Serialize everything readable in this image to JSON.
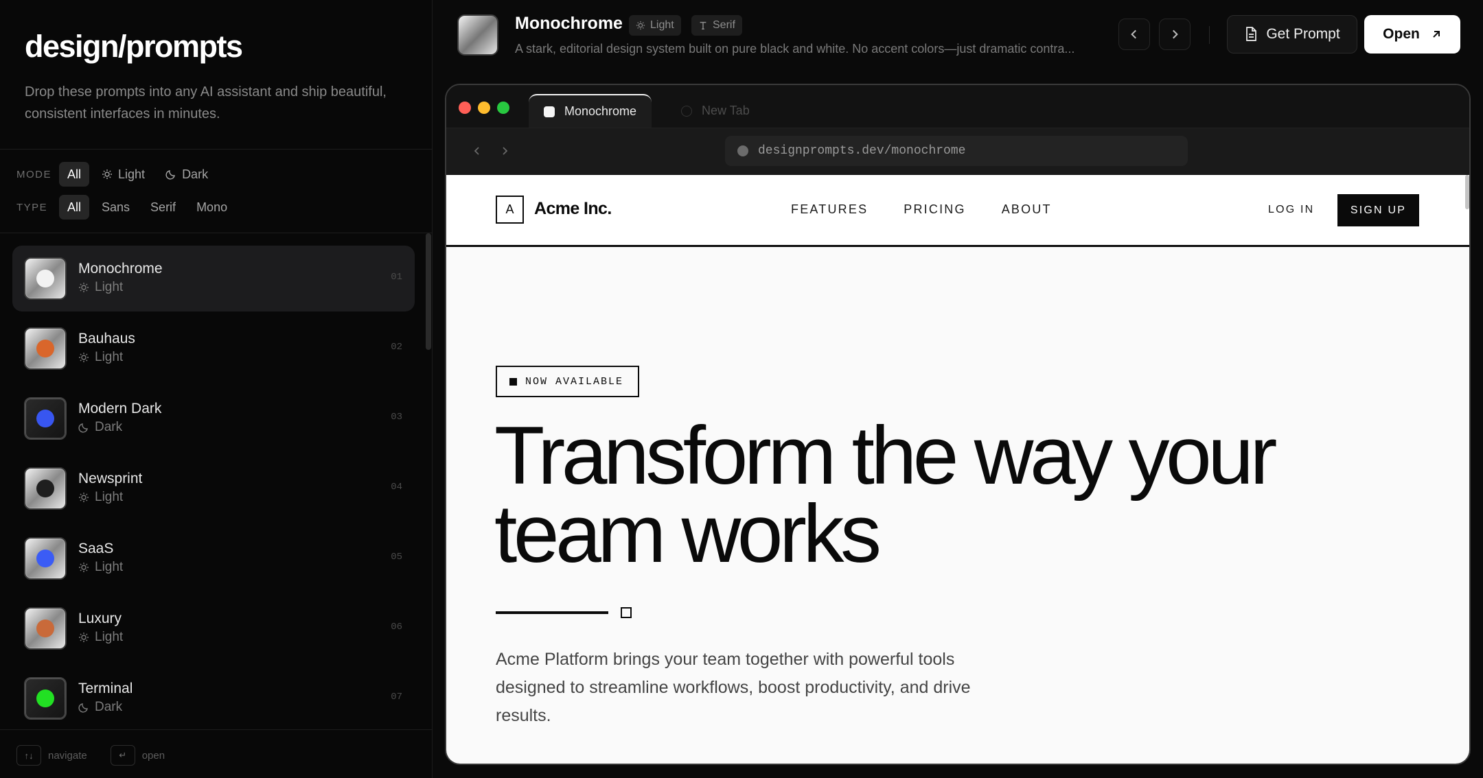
{
  "sidebar": {
    "brand": "design/prompts",
    "tagline": "Drop these prompts into any AI assistant and ship beautiful, consistent interfaces in minutes.",
    "mode_filter": {
      "label": "MODE",
      "options": [
        {
          "label": "All",
          "icon": "",
          "active": true
        },
        {
          "label": "Light",
          "icon": "sun-icon",
          "active": false
        },
        {
          "label": "Dark",
          "icon": "moon-icon",
          "active": false
        }
      ]
    },
    "type_filter": {
      "label": "TYPE",
      "options": [
        {
          "label": "All",
          "active": true
        },
        {
          "label": "Sans",
          "active": false
        },
        {
          "label": "Serif",
          "active": false
        },
        {
          "label": "Mono",
          "active": false
        }
      ]
    },
    "items": [
      {
        "name": "Monochrome",
        "mode": "Light",
        "mode_icon": "sun-icon",
        "num": "01",
        "dot": "#f2f2f2",
        "active": true,
        "dark": false
      },
      {
        "name": "Bauhaus",
        "mode": "Light",
        "mode_icon": "sun-icon",
        "num": "02",
        "dot": "#d9662b",
        "active": false,
        "dark": false
      },
      {
        "name": "Modern Dark",
        "mode": "Dark",
        "mode_icon": "moon-icon",
        "num": "03",
        "dot": "#3856f0",
        "active": false,
        "dark": true
      },
      {
        "name": "Newsprint",
        "mode": "Light",
        "mode_icon": "sun-icon",
        "num": "04",
        "dot": "#1f1f1f",
        "active": false,
        "dark": false
      },
      {
        "name": "SaaS",
        "mode": "Light",
        "mode_icon": "sun-icon",
        "num": "05",
        "dot": "#3b5cf5",
        "active": false,
        "dark": false
      },
      {
        "name": "Luxury",
        "mode": "Light",
        "mode_icon": "sun-icon",
        "num": "06",
        "dot": "#c96a3a",
        "active": false,
        "dark": false
      },
      {
        "name": "Terminal",
        "mode": "Dark",
        "mode_icon": "moon-icon",
        "num": "07",
        "dot": "#22e023",
        "active": false,
        "dark": true
      }
    ],
    "footer": {
      "nav_key": "↑↓",
      "nav_label": "navigate",
      "open_key": "↵",
      "open_label": "open"
    }
  },
  "header": {
    "title": "Monochrome",
    "badge_mode": "Light",
    "badge_type": "Serif",
    "description": "A stark, editorial design system built on pure black and white. No accent colors—just dramatic contra...",
    "get_prompt_label": "Get Prompt",
    "open_label": "Open"
  },
  "browser": {
    "active_tab": "Monochrome",
    "inactive_tab": "New Tab",
    "url": "designprompts.dev/monochrome",
    "traffic_lights": [
      "#ff5f57",
      "#febc2e",
      "#28c840"
    ]
  },
  "site": {
    "logo_letter": "A",
    "logo_text": "Acme Inc.",
    "nav_links": [
      "FEATURES",
      "PRICING",
      "ABOUT"
    ],
    "login": "LOG IN",
    "signup": "SIGN UP",
    "badge": "NOW AVAILABLE",
    "hero_line1": "Transform the way your",
    "hero_line2": "team works",
    "subtitle": "Acme Platform brings your team together with powerful tools designed to streamline workflows, boost productivity, and drive results."
  }
}
